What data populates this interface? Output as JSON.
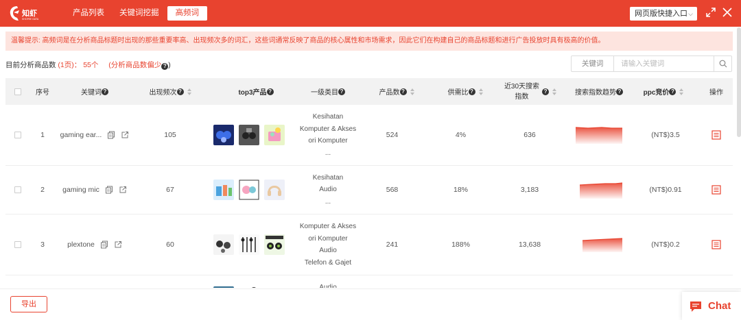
{
  "topbar": {
    "logo_text": "知虾",
    "nav": [
      "产品列表",
      "关键词挖掘",
      "高频词"
    ],
    "active_index": 2,
    "quick_entry": "网页版快捷入口"
  },
  "notice": "温馨提示: 高频词是在分析商品标题时出现的那些重要率高、出现频次多的词汇，这些词通常反映了商品的核心属性和市场需求，因此它们在构建自己的商品标题和进行广告投放时具有极高的价值。",
  "summary": {
    "prefix": "目前分析商品数",
    "pages": "(1页)：",
    "count": "55个",
    "hint": "(分析商品数偏少",
    "hint_end": ")"
  },
  "search": {
    "type_label": "关键词",
    "placeholder": "请输入关键词"
  },
  "table": {
    "headers": {
      "index": "序号",
      "keyword": "关键词",
      "frequency": "出现频次",
      "top3": "top3产品",
      "category": "一级类目",
      "products": "产品数",
      "supply_demand": "供需比",
      "search30_line1": "近30天搜索",
      "search30_line2": "指数",
      "trend": "搜索指数趋势",
      "ppc": "ppc竞价",
      "action": "操作"
    },
    "rows": [
      {
        "index": "1",
        "keyword": "gaming ear...",
        "frequency": "105",
        "categories": [
          "Kesihatan",
          "Komputer & Akses",
          "ori Komputer",
          "..."
        ],
        "products": "524",
        "ratio": "4%",
        "search30": "636",
        "ppc": "(NT$)3.5"
      },
      {
        "index": "2",
        "keyword": "gaming mic",
        "frequency": "67",
        "categories": [
          "Kesihatan",
          "Audio",
          "..."
        ],
        "products": "568",
        "ratio": "18%",
        "search30": "3,183",
        "ppc": "(NT$)0.91"
      },
      {
        "index": "3",
        "keyword": "plextone",
        "frequency": "60",
        "categories": [
          "Komputer & Akses",
          "ori Komputer",
          "Audio",
          "Telefon & Gajet"
        ],
        "products": "241",
        "ratio": "188%",
        "search30": "13,638",
        "ppc": "(NT$)0.2"
      },
      {
        "index": "",
        "keyword": "",
        "frequency": "",
        "categories": [
          "Audio"
        ],
        "products": "",
        "ratio": "",
        "search30": "",
        "ppc": ""
      }
    ]
  },
  "footer": {
    "export": "导出",
    "chat": "Chat"
  },
  "colors": {
    "brand": "#e8432f",
    "notice_bg": "#fde4df",
    "header_bg": "#f2f2f2"
  }
}
